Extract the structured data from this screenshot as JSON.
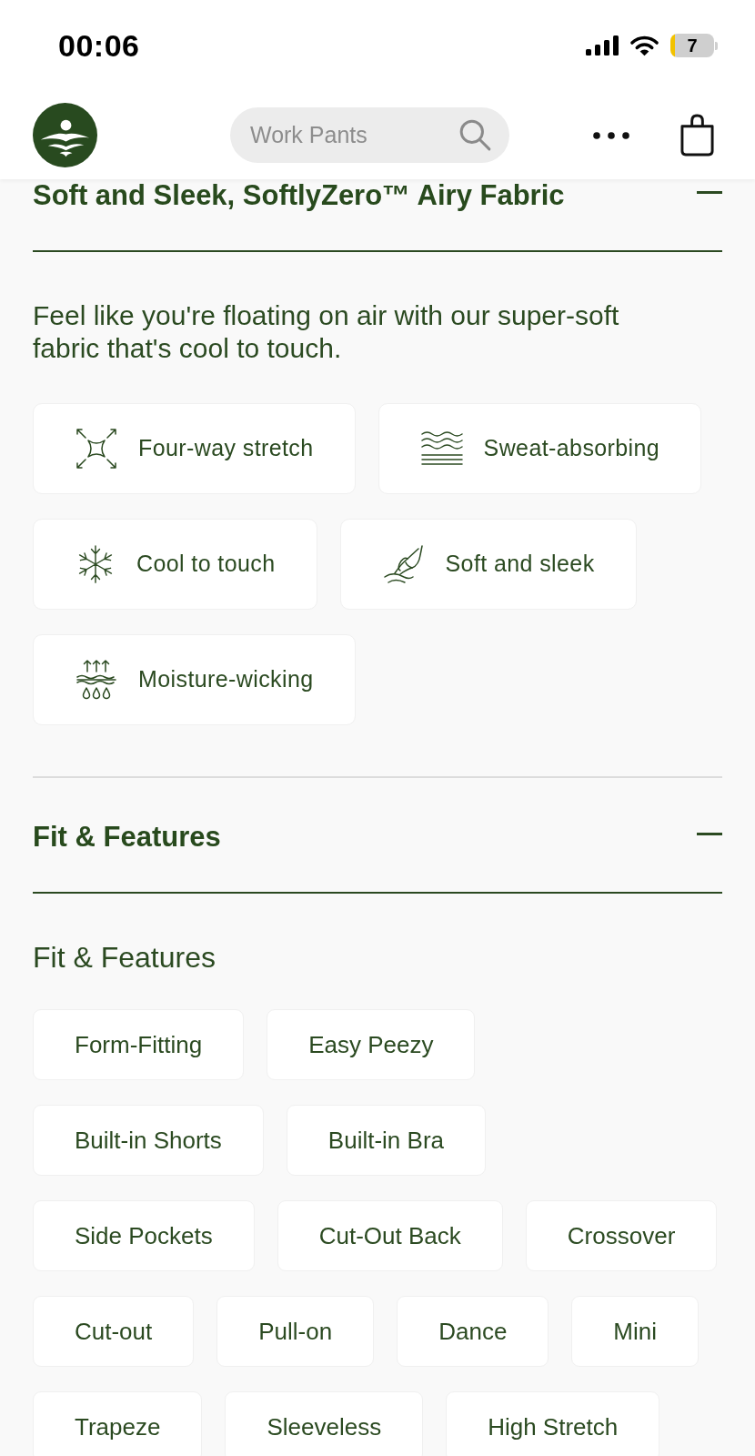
{
  "status_bar": {
    "time": "00:06",
    "battery": "7"
  },
  "header": {
    "search": {
      "placeholder": "Work Pants"
    }
  },
  "sections": [
    {
      "title": "Soft and Sleek, SoftlyZero™ Airy Fabric",
      "expanded": true,
      "description": "Feel like you're floating on air with our super-soft fabric that's cool to touch.",
      "feature_rows": [
        [
          {
            "kind": "stretch",
            "label": "Four-way stretch"
          },
          {
            "kind": "waves",
            "label": "Sweat-absorbing"
          }
        ],
        [
          {
            "kind": "snowflake",
            "label": "Cool to touch"
          },
          {
            "kind": "hand",
            "label": "Soft and sleek"
          }
        ],
        [
          {
            "kind": "moisture",
            "label": "Moisture-wicking"
          }
        ]
      ]
    },
    {
      "title": "Fit & Features",
      "expanded": true,
      "subtitle": "Fit & Features",
      "tag_rows": [
        [
          "Form-Fitting",
          "Easy Peezy"
        ],
        [
          "Built-in Shorts",
          "Built-in Bra"
        ],
        [
          "Side Pockets",
          "Cut-Out Back",
          "Crossover"
        ],
        [
          "Cut-out",
          "Pull-on",
          "Dance",
          "Mini"
        ],
        [
          "Trapeze",
          "Sleeveless",
          "High Stretch"
        ]
      ]
    }
  ]
}
